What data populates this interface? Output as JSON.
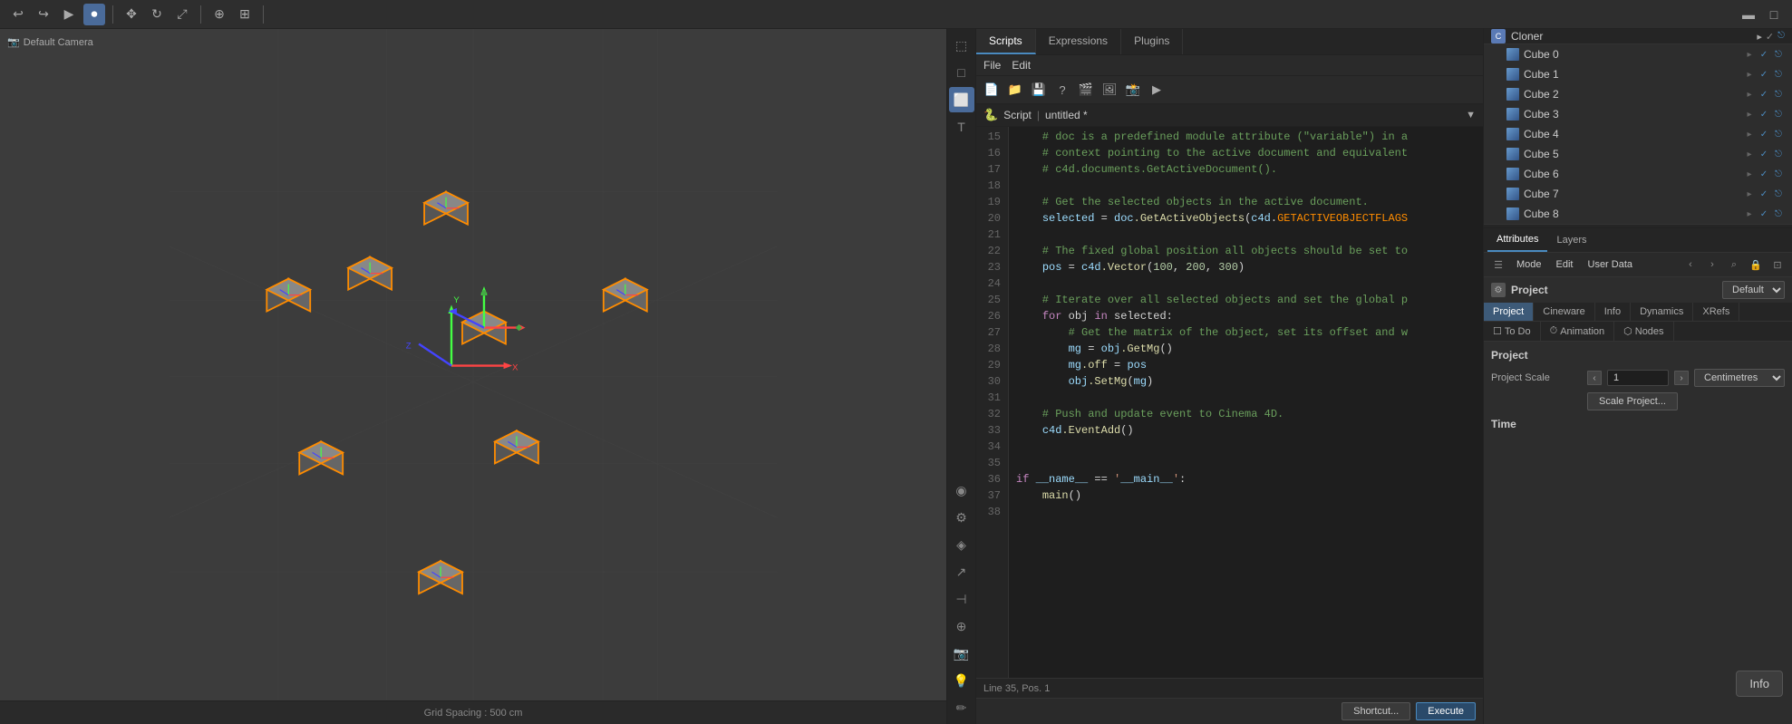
{
  "toolbar": {
    "icons": [
      "↩",
      "↪",
      "▶",
      "⏺",
      "✂",
      "⎘",
      "📋",
      "↩",
      "↪",
      "🔒",
      "⊞",
      "☀",
      "⟳",
      "⊕",
      "⛶",
      "▣",
      "◈"
    ]
  },
  "viewport": {
    "label": "Default Camera",
    "camera_icon": "📷",
    "grid_spacing": "Grid Spacing : 500 cm"
  },
  "script_editor": {
    "tabs": [
      {
        "label": "Scripts",
        "active": true
      },
      {
        "label": "Expressions",
        "active": false
      },
      {
        "label": "Plugins",
        "active": false
      }
    ],
    "menu_items": [
      "File",
      "Edit"
    ],
    "file_label": "Script",
    "file_name": "untitled *",
    "status": "Line 35, Pos. 1",
    "shortcut_btn": "Shortcut...",
    "execute_btn": "Execute",
    "code_lines": [
      {
        "num": "15",
        "content": "    # doc is a predefined module attribute (\"variable\") in a",
        "type": "comment"
      },
      {
        "num": "16",
        "content": "    # context pointing to the active document and equivalent",
        "type": "comment"
      },
      {
        "num": "17",
        "content": "    # c4d.documents.GetActiveDocument().",
        "type": "comment"
      },
      {
        "num": "18",
        "content": "",
        "type": "default"
      },
      {
        "num": "19",
        "content": "    # Get the selected objects in the active document.",
        "type": "comment"
      },
      {
        "num": "20",
        "content": "    selected = doc.GetActiveObjects(c4d.GETACTIVEOBJECTFLAGS",
        "type": "mixed"
      },
      {
        "num": "21",
        "content": "",
        "type": "default"
      },
      {
        "num": "22",
        "content": "    # The fixed global position all objects should be set to",
        "type": "comment"
      },
      {
        "num": "23",
        "content": "    pos = c4d.Vector(100, 200, 300)",
        "type": "code"
      },
      {
        "num": "24",
        "content": "",
        "type": "default"
      },
      {
        "num": "25",
        "content": "    # Iterate over all selected objects and set the global p",
        "type": "comment"
      },
      {
        "num": "26",
        "content": "    for obj in selected:",
        "type": "keyword"
      },
      {
        "num": "27",
        "content": "        # Get the matrix of the object, set its offset and w",
        "type": "comment"
      },
      {
        "num": "28",
        "content": "        mg = obj.GetMg()",
        "type": "code"
      },
      {
        "num": "29",
        "content": "        mg.off = pos",
        "type": "code"
      },
      {
        "num": "30",
        "content": "        obj.SetMg(mg)",
        "type": "code"
      },
      {
        "num": "31",
        "content": "",
        "type": "default"
      },
      {
        "num": "32",
        "content": "    # Push and update event to Cinema 4D.",
        "type": "comment"
      },
      {
        "num": "33",
        "content": "    c4d.EventAdd()",
        "type": "code"
      },
      {
        "num": "34",
        "content": "",
        "type": "default"
      },
      {
        "num": "35",
        "content": "",
        "type": "default"
      },
      {
        "num": "36",
        "content": "if __name__ == '__main__':",
        "type": "keyword_main"
      },
      {
        "num": "37",
        "content": "    main()",
        "type": "code"
      },
      {
        "num": "38",
        "content": "",
        "type": "default"
      }
    ]
  },
  "object_list": {
    "cloner_label": "Cloner",
    "items": [
      {
        "name": "Cube 0",
        "indent": 1
      },
      {
        "name": "Cube 1",
        "indent": 1
      },
      {
        "name": "Cube 2",
        "indent": 1
      },
      {
        "name": "Cube 3",
        "indent": 1
      },
      {
        "name": "Cube 4",
        "indent": 1
      },
      {
        "name": "Cube 5",
        "indent": 1
      },
      {
        "name": "Cube 6",
        "indent": 1
      },
      {
        "name": "Cube 7",
        "indent": 1
      },
      {
        "name": "Cube 8",
        "indent": 1
      }
    ]
  },
  "attributes": {
    "tabs": [
      "Attributes",
      "Layers"
    ],
    "toolbar_items": [
      "Mode",
      "Edit",
      "User Data"
    ],
    "project_label": "Project",
    "default_dropdown": "Default",
    "sub_tabs": [
      "Project",
      "Cineware",
      "Info",
      "Dynamics",
      "XRefs"
    ],
    "sub_tabs2": [
      "To Do",
      "Animation",
      "Nodes"
    ],
    "section_title": "Project",
    "field_project_scale_label": "Project Scale",
    "field_project_scale_value": "1",
    "field_project_scale_unit": "Centimetres",
    "scale_project_btn": "Scale Project...",
    "time_label": "Time",
    "info_badge": "Info"
  },
  "icons": {
    "arrow_left": "‹",
    "arrow_right": "›",
    "search": "⌕",
    "lock": "🔒",
    "expand": "⊡"
  }
}
